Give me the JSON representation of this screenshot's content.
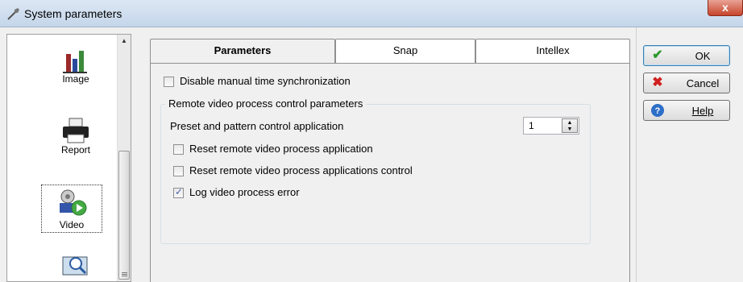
{
  "window": {
    "title": "System parameters",
    "close_label": "x"
  },
  "sidebar": {
    "items": [
      {
        "label": "Image",
        "icon": "bar-chart-icon"
      },
      {
        "label": "Report",
        "icon": "printer-icon"
      },
      {
        "label": "Video",
        "icon": "video-camera-icon",
        "selected": true
      },
      {
        "label": "",
        "icon": "magnifier-screen-icon"
      }
    ]
  },
  "tabs": [
    {
      "label": "Parameters",
      "active": true
    },
    {
      "label": "Snap",
      "active": false
    },
    {
      "label": "Intellex",
      "active": false
    }
  ],
  "params": {
    "disable_time_sync": {
      "label": "Disable manual time synchronization",
      "checked": false
    },
    "group_title": "Remote video process control parameters",
    "preset_label": "Preset and pattern control application",
    "preset_value": "1",
    "reset_app": {
      "label": "Reset remote video process application",
      "checked": false
    },
    "reset_control": {
      "label": "Reset remote video process applications control",
      "checked": false
    },
    "log_error": {
      "label": "Log video process error",
      "checked": true
    }
  },
  "buttons": {
    "ok": "OK",
    "cancel": "Cancel",
    "help": "Help"
  },
  "colors": {
    "titlebar": "#c5d6ea",
    "ok_icon": "#2e9a2e",
    "cancel_icon": "#d02020",
    "help_icon": "#2d6ec8"
  }
}
